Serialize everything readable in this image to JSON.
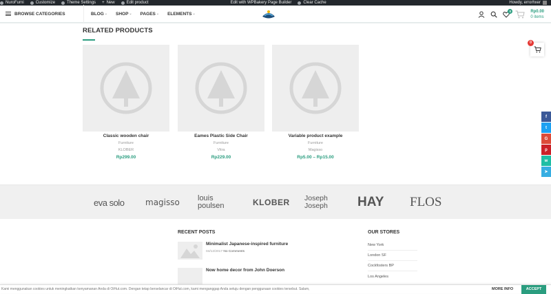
{
  "admin_bar": {
    "items": [
      "NuroFurni",
      "Customize",
      "Theme Settings",
      "New",
      "Edit product",
      "Edit with WPBakery Page Builder",
      "Clear Cache"
    ],
    "greeting": "Howdy, errorhxer"
  },
  "header": {
    "browse_label": "BROWSE CATEGORIES",
    "nav": [
      "BLOG",
      "SHOP",
      "PAGES",
      "ELEMENTS"
    ],
    "wishlist_count": "0",
    "cart_amount": "Rp0.00",
    "cart_items": "0 items"
  },
  "related": {
    "title": "RELATED PRODUCTS",
    "products": [
      {
        "name": "Classic wooden chair",
        "category": "Furniture",
        "brand": "KLOBER",
        "price": "Rp299.00"
      },
      {
        "name": "Eames Plastic Side Chair",
        "category": "Furniture",
        "brand": "Vitra",
        "price": "Rp229.00"
      },
      {
        "name": "Variable product example",
        "category": "Furniture",
        "brand": "Magisso",
        "price": "Rp5.00 – Rp15.00"
      }
    ]
  },
  "side_cart_badge": "0",
  "social": [
    {
      "name": "facebook",
      "glyph": "f",
      "color": "#3b5998"
    },
    {
      "name": "twitter",
      "glyph": "t",
      "color": "#1da1f2"
    },
    {
      "name": "google-plus",
      "glyph": "G",
      "color": "#dd4b39"
    },
    {
      "name": "pinterest",
      "glyph": "p",
      "color": "#cb2027"
    },
    {
      "name": "whatsapp",
      "glyph": "w",
      "color": "#1ebea5"
    },
    {
      "name": "telegram",
      "glyph": "➤",
      "color": "#37aee2"
    }
  ],
  "brands": [
    "eva solo",
    "magisso",
    "louis poulsen",
    "KLOBER",
    "Joseph Joseph",
    "HAY",
    "FLOS"
  ],
  "footer": {
    "recent_posts_title": "RECENT POSTS",
    "posts": [
      {
        "title": "Minimalist Japanese-inspired furniture",
        "date": "04/12/2017",
        "comments": "No Comments"
      },
      {
        "title": "Now home decor from John Doerson",
        "date": "",
        "comments": ""
      }
    ],
    "stores_title": "OUR STORES",
    "stores": [
      "New York",
      "London SF",
      "Cockfosters BP",
      "Los Angeles"
    ]
  },
  "cookie": {
    "text": "Kami menggunakan cookies untuk meningkatkan kenyamanan Anda di OiHut.com. Dengan tetap berselancar di OiHut.com, kami menganggap Anda setuju dengan penggunaan cookies tersebut. Salam,",
    "more": "MORE INFO",
    "accept": "ACCEPT"
  }
}
